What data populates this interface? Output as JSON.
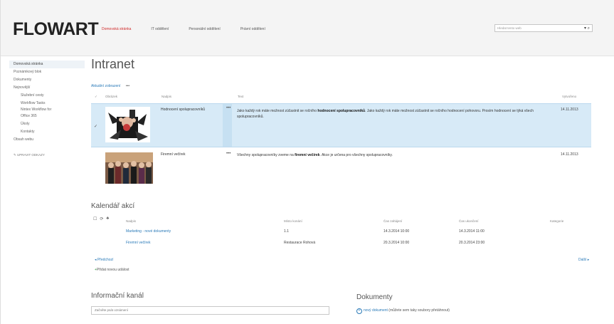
{
  "brand": {
    "logo": "FLOWART"
  },
  "topnav": [
    {
      "label": "Domovská stránka",
      "active": true
    },
    {
      "label": "IT oddělení",
      "active": false
    },
    {
      "label": "Personální oddělení",
      "active": false
    },
    {
      "label": "Právní oddělení",
      "active": false
    }
  ],
  "search": {
    "placeholder": "Hledat tento web",
    "btn": "▾ ⌕"
  },
  "leftnav": {
    "items": [
      {
        "label": "Domovská stránka",
        "selected": true,
        "sub": false
      },
      {
        "label": "Poznámkový blok",
        "selected": false,
        "sub": false
      },
      {
        "label": "Dokumenty",
        "selected": false,
        "sub": false
      },
      {
        "label": "Nejnovější",
        "selected": false,
        "sub": false
      },
      {
        "label": "Služební cesty",
        "selected": false,
        "sub": true
      },
      {
        "label": "Workflow Tasks",
        "selected": false,
        "sub": true
      },
      {
        "label": "Nintex Workflow for",
        "selected": false,
        "sub": true
      },
      {
        "label": "Office 365",
        "selected": false,
        "sub": true
      },
      {
        "label": "Úkoly",
        "selected": false,
        "sub": true
      },
      {
        "label": "Kontakty",
        "selected": false,
        "sub": true
      },
      {
        "label": "Obsah webu",
        "selected": false,
        "sub": false
      }
    ],
    "edit": "✎ UPRAVIT ODKAZY"
  },
  "page": {
    "title": "Intranet",
    "view": "Aktuální zobrazení",
    "dots": "•••"
  },
  "news": {
    "headers": {
      "image": "Obrázek",
      "title": "Nadpis",
      "text": "Text",
      "date": "Vytvořeno"
    },
    "rows": [
      {
        "title": "Hodnocení spolupracovníků",
        "text_pre": "Jako každý rok máte možnost zúčastnit se ročního ",
        "text_bold": "hodnocení spolupracovníků",
        "text_post": ". Jako každý rok máte možnost zúčastnit se ročního hodnocení pohovoru. Prosím hodnocení se týká všech spolupracovníků.",
        "date": "14.11.2013",
        "checked": "✓"
      },
      {
        "title": "Firemní večírek",
        "text_pre": "Všechny spolupracovníky zveme na ",
        "text_bold": "firemní večírek",
        "text_post": ". Akce je určena pro všechny spolupracovníky.",
        "date": "14.11.2013",
        "checked": ""
      }
    ]
  },
  "calendar": {
    "title": "Kalendář akcí",
    "headers": {
      "title": "Nadpis",
      "place": "Místo konání",
      "start": "Čas zahájení",
      "end": "Čas ukončení",
      "cat": "Kategorie"
    },
    "rows": [
      {
        "title": "Marketing - nové dokumenty",
        "place": "1.1",
        "start": "14.3.2014 10:00",
        "end": "14.3.2014 11:00"
      },
      {
        "title": "Firemní večírek",
        "place": "Restaurace Rohová",
        "start": "20.3.2014 10:00",
        "end": "20.3.2014 23:00"
      }
    ],
    "prev": "◂ Předchozí",
    "next": "Další ▸",
    "add": "Přidat novou událost",
    "add_icon": "+"
  },
  "info": {
    "title": "Informační kanál",
    "placeholder": "Začněte psát oznámení"
  },
  "docs": {
    "title": "Dokumenty",
    "new_link": "nový dokument",
    "new_tail": " (můžete sem taky soubory přetáhnout)",
    "plus": "+"
  }
}
